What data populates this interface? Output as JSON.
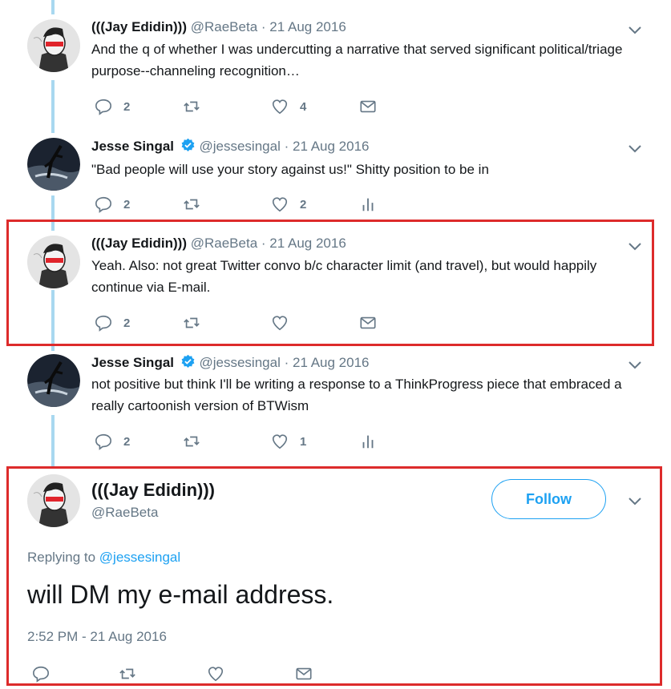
{
  "tweets": [
    {
      "name": "(((Jay Edidin)))",
      "handle": "@RaeBeta",
      "date": "21 Aug 2016",
      "text": "And the q of whether I was undercutting a narrative that served significant political/triage purpose--channeling recognition…",
      "replies": "2",
      "retweets": "",
      "likes": "4",
      "last_action_icon": "mail-icon"
    },
    {
      "name": "Jesse Singal",
      "handle": "@jessesingal",
      "date": "21 Aug 2016",
      "text": "\"Bad people will use your story against us!\" Shitty position to be in",
      "replies": "2",
      "retweets": "",
      "likes": "2",
      "last_action_icon": "analytics-icon"
    },
    {
      "name": "(((Jay Edidin)))",
      "handle": "@RaeBeta",
      "date": "21 Aug 2016",
      "text": "Yeah. Also: not great Twitter convo b/c character limit (and travel), but would happily continue via E-mail.",
      "replies": "2",
      "retweets": "",
      "likes": "",
      "last_action_icon": "mail-icon"
    },
    {
      "name": "Jesse Singal",
      "handle": "@jessesingal",
      "date": "21 Aug 2016",
      "text": "not positive but think I'll be writing a response to a ThinkProgress piece that embraced a really cartoonish version of BTWism",
      "replies": "2",
      "retweets": "",
      "likes": "1",
      "last_action_icon": "analytics-icon"
    }
  ],
  "main_tweet": {
    "name": "(((Jay Edidin)))",
    "handle": "@RaeBeta",
    "follow_label": "Follow",
    "replying_prefix": "Replying to ",
    "replying_to": "@jessesingal",
    "text": "will DM my e-mail address.",
    "timestamp": "2:52 PM - 21 Aug 2016"
  },
  "separator": "·",
  "colors": {
    "accent": "#1da1f2",
    "highlight_border": "#dd2b2b",
    "thread_line": "#a8d8f0",
    "muted_text": "#657786"
  }
}
